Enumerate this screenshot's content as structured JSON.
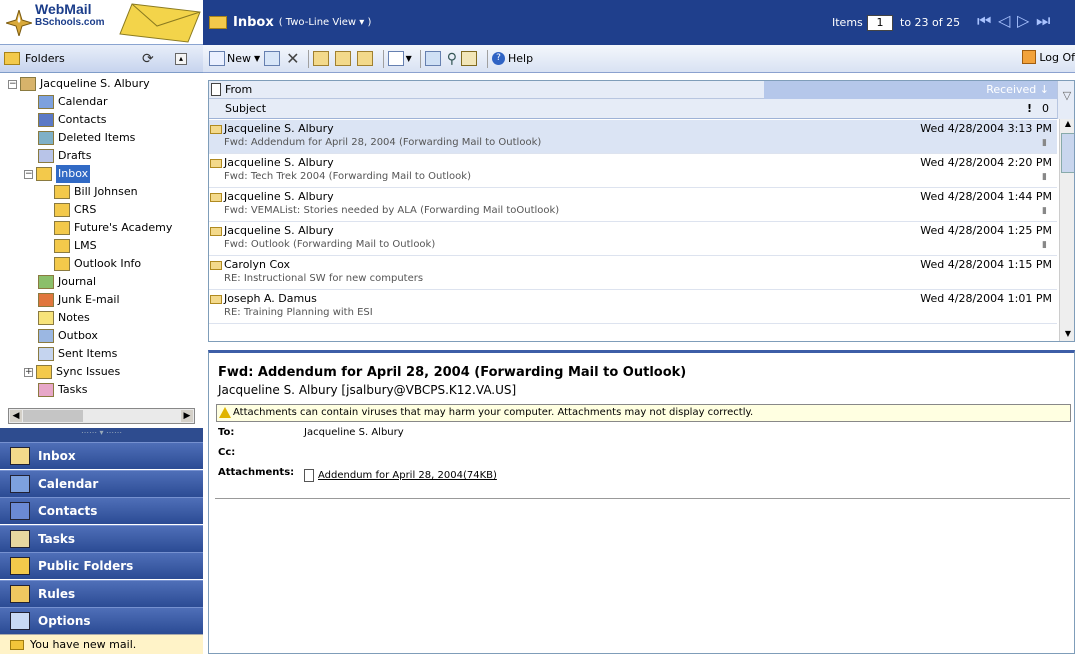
{
  "logo": {
    "line1": "WebMail",
    "line2": "BSchools.com"
  },
  "folders_header": {
    "label": "Folders"
  },
  "tree": [
    {
      "label": "Jacqueline S. Albury",
      "icon": "mailbox-icon",
      "indent": 0,
      "exp": "minus"
    },
    {
      "label": "Calendar",
      "icon": "calendar-icon",
      "indent": 2
    },
    {
      "label": "Contacts",
      "icon": "contacts-icon",
      "indent": 2
    },
    {
      "label": "Deleted Items",
      "icon": "trash-icon",
      "indent": 2
    },
    {
      "label": "Drafts",
      "icon": "drafts-icon",
      "indent": 2
    },
    {
      "label": "Inbox",
      "icon": "inbox-folder-icon",
      "indent": 1,
      "exp": "minus",
      "selected": true
    },
    {
      "label": "Bill Johnsen",
      "icon": "folder-icon",
      "indent": 3
    },
    {
      "label": "CRS",
      "icon": "folder-icon",
      "indent": 3
    },
    {
      "label": "Future's Academy",
      "icon": "folder-icon",
      "indent": 3
    },
    {
      "label": "LMS",
      "icon": "folder-icon",
      "indent": 3
    },
    {
      "label": "Outlook Info",
      "icon": "folder-icon",
      "indent": 3
    },
    {
      "label": "Journal",
      "icon": "journal-icon",
      "indent": 2
    },
    {
      "label": "Junk E-mail",
      "icon": "junk-icon",
      "indent": 2
    },
    {
      "label": "Notes",
      "icon": "notes-icon",
      "indent": 2
    },
    {
      "label": "Outbox",
      "icon": "outbox-icon",
      "indent": 2
    },
    {
      "label": "Sent Items",
      "icon": "sent-icon",
      "indent": 2
    },
    {
      "label": "Sync Issues",
      "icon": "folder-icon",
      "indent": 1,
      "exp": "plus"
    },
    {
      "label": "Tasks",
      "icon": "tasks-icon",
      "indent": 2
    }
  ],
  "nav_buttons": [
    {
      "label": "Inbox",
      "icon": "inbox-icon"
    },
    {
      "label": "Calendar",
      "icon": "calendar-icon"
    },
    {
      "label": "Contacts",
      "icon": "contacts-icon"
    },
    {
      "label": "Tasks",
      "icon": "tasks-icon"
    },
    {
      "label": "Public Folders",
      "icon": "public-folders-icon"
    },
    {
      "label": "Rules",
      "icon": "rules-icon"
    },
    {
      "label": "Options",
      "icon": "options-icon"
    }
  ],
  "status": {
    "new_mail": "You have new mail."
  },
  "topbar": {
    "title": "Inbox",
    "view": "( Two-Line View ▾ )",
    "items_label": "Items",
    "page": "1",
    "range": "to 23 of 25"
  },
  "toolbar": {
    "new_label": "New",
    "help_label": "Help",
    "logoff_label": "Log Of"
  },
  "list_header": {
    "from": "From",
    "subject": "Subject",
    "received": "Received"
  },
  "messages": [
    {
      "from": "Jacqueline S. Albury",
      "subject": "Fwd: Addendum for April 28, 2004 (Forwarding Mail to Outlook)",
      "date": "Wed 4/28/2004 3:13 PM",
      "attach": true,
      "selected": true
    },
    {
      "from": "Jacqueline S. Albury",
      "subject": "Fwd: Tech Trek 2004 (Forwarding Mail to Outlook)",
      "date": "Wed 4/28/2004 2:20 PM",
      "attach": true
    },
    {
      "from": "Jacqueline S. Albury",
      "subject": "Fwd: VEMAList: Stories needed by ALA (Forwarding Mail toOutlook)",
      "date": "Wed 4/28/2004 1:44 PM",
      "attach": true
    },
    {
      "from": "Jacqueline S. Albury",
      "subject": "Fwd: Outlook (Forwarding Mail to Outlook)",
      "date": "Wed 4/28/2004 1:25 PM",
      "attach": true
    },
    {
      "from": "Carolyn Cox",
      "subject": "RE: Instructional SW for new computers",
      "date": "Wed 4/28/2004 1:15 PM",
      "attach": false
    },
    {
      "from": "Joseph A. Damus",
      "subject": "RE: Training Planning with ESI",
      "date": "Wed 4/28/2004 1:01 PM",
      "attach": false
    }
  ],
  "preview": {
    "subject": "Fwd: Addendum for April 28, 2004 (Forwarding Mail to Outlook)",
    "from": "Jacqueline S. Albury [jsalbury@VBCPS.K12.VA.US]",
    "warning": "Attachments can contain viruses that may harm your computer. Attachments may not display correctly.",
    "to_label": "To:",
    "to_value": "Jacqueline S. Albury",
    "cc_label": "Cc:",
    "att_label": "Attachments:",
    "attachment": "Addendum for April 28, 2004(74KB)"
  },
  "colors": {
    "nav_dark": "#2b4b94",
    "topbar": "#1f3f8c",
    "selection": "#316ac5"
  }
}
